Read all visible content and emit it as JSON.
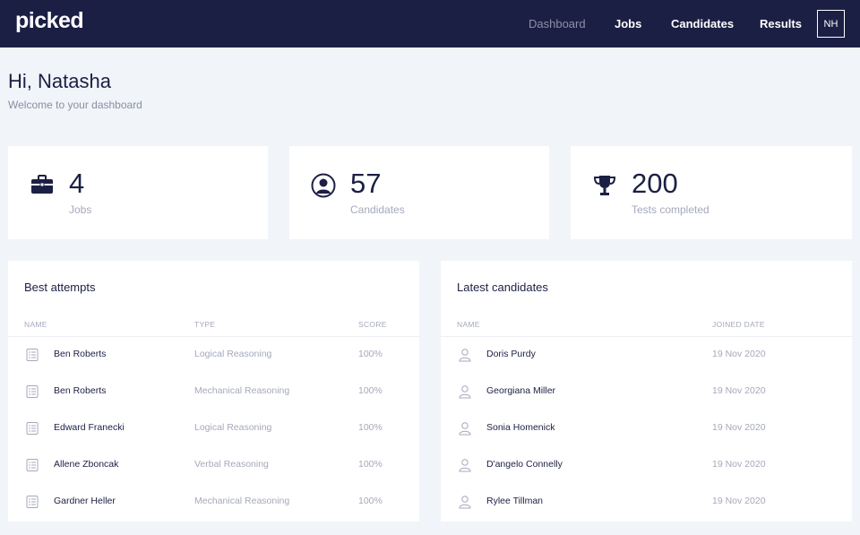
{
  "app": {
    "logo": "picked"
  },
  "nav": {
    "items": [
      {
        "label": "Dashboard",
        "active": true
      },
      {
        "label": "Jobs",
        "active": false
      },
      {
        "label": "Candidates",
        "active": false
      },
      {
        "label": "Results",
        "active": false
      }
    ],
    "avatar_initials": "NH"
  },
  "greeting": {
    "title": "Hi, Natasha",
    "subtitle": "Welcome to your dashboard"
  },
  "stats": [
    {
      "icon": "briefcase-icon",
      "value": "4",
      "label": "Jobs"
    },
    {
      "icon": "user-icon",
      "value": "57",
      "label": "Candidates"
    },
    {
      "icon": "trophy-icon",
      "value": "200",
      "label": "Tests completed"
    }
  ],
  "best_attempts": {
    "title": "Best attempts",
    "columns": [
      "NAME",
      "TYPE",
      "SCORE"
    ],
    "rows": [
      {
        "name": "Ben Roberts",
        "type": "Logical Reasoning",
        "score": "100%"
      },
      {
        "name": "Ben Roberts",
        "type": "Mechanical Reasoning",
        "score": "100%"
      },
      {
        "name": "Edward Franecki",
        "type": "Logical Reasoning",
        "score": "100%"
      },
      {
        "name": "Allene Zboncak",
        "type": "Verbal Reasoning",
        "score": "100%"
      },
      {
        "name": "Gardner Heller",
        "type": "Mechanical Reasoning",
        "score": "100%"
      }
    ]
  },
  "latest_candidates": {
    "title": "Latest candidates",
    "columns": [
      "NAME",
      "JOINED DATE"
    ],
    "rows": [
      {
        "name": "Doris Purdy",
        "date": "19 Nov 2020"
      },
      {
        "name": "Georgiana Miller",
        "date": "19 Nov 2020"
      },
      {
        "name": "Sonia Homenick",
        "date": "19 Nov 2020"
      },
      {
        "name": "D'angelo Connelly",
        "date": "19 Nov 2020"
      },
      {
        "name": "Rylee Tillman",
        "date": "19 Nov 2020"
      }
    ]
  },
  "colors": {
    "nav_bg": "#1c1f44",
    "page_bg": "#f1f4f8",
    "text_dark": "#1c1f44",
    "text_muted": "#a5a9bb"
  }
}
